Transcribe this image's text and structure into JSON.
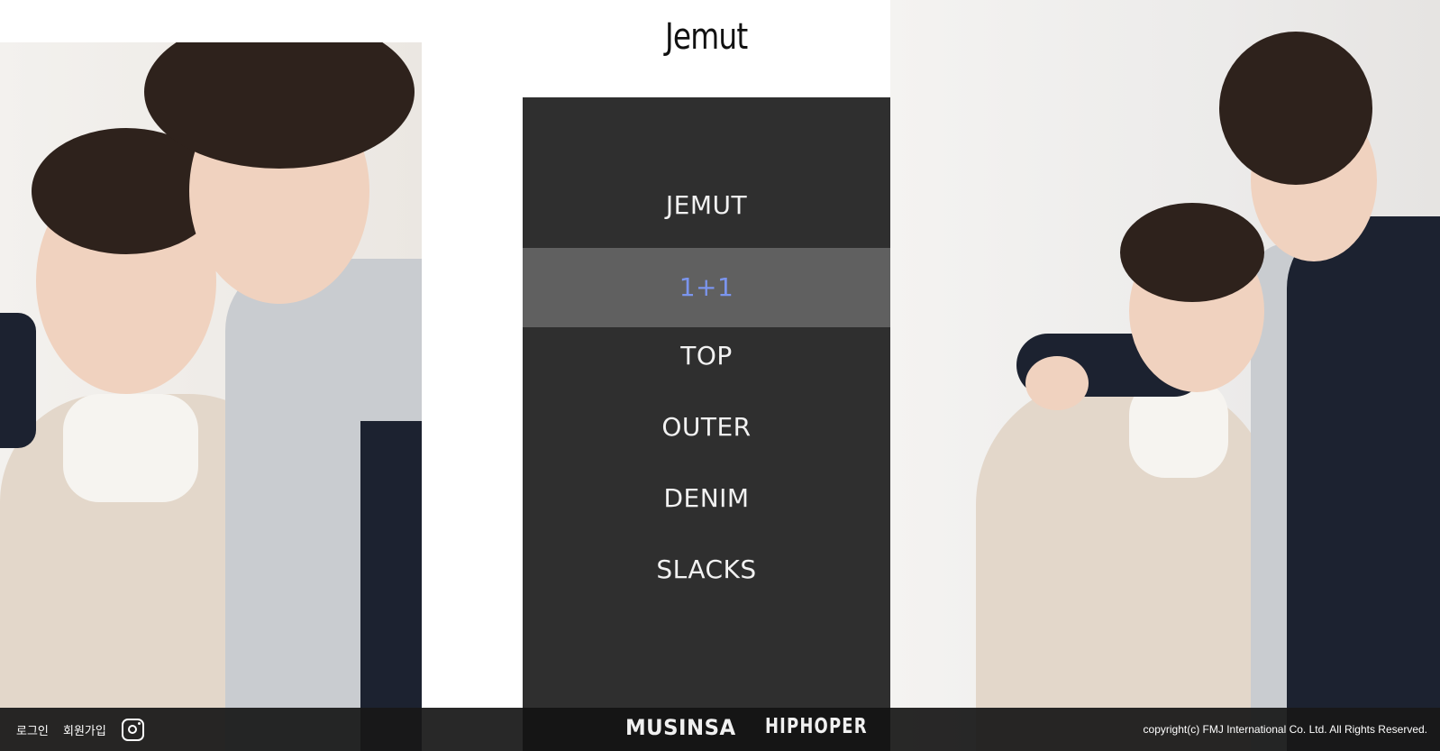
{
  "logo": {
    "text": "Jemut"
  },
  "menu": {
    "items": [
      {
        "label": "JEMUT",
        "active": false
      },
      {
        "label": "1+1",
        "active": true
      },
      {
        "label": "TOP",
        "active": false
      },
      {
        "label": "OUTER",
        "active": false
      },
      {
        "label": "DENIM",
        "active": false
      },
      {
        "label": "SLACKS",
        "active": false
      }
    ]
  },
  "footer": {
    "login_label": "로그인",
    "signup_label": "회원가입",
    "instagram_icon": "instagram-icon",
    "brands": [
      "MUSINSA",
      "HIPHOPER"
    ],
    "copyright": "copyright(c) FMJ International Co. Ltd. All Rights Reserved."
  },
  "colors": {
    "menu_bg": "#2f2f2f",
    "menu_active_bg": "#606060",
    "menu_active_text": "#7b95ee",
    "menu_text": "#f2f2f2",
    "footer_bg": "#181818"
  }
}
